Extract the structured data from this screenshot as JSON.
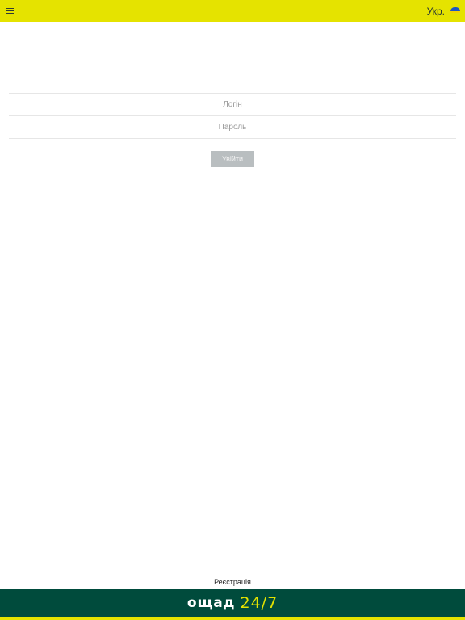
{
  "header": {
    "language_label": "Укр.",
    "menu_icon": "hamburger-menu-icon",
    "flag_icon": "ukraine-flag-icon",
    "accent_color": "#e5e300"
  },
  "login_form": {
    "login_placeholder": "Логін",
    "password_placeholder": "Пароль",
    "login_value": "",
    "password_value": "",
    "submit_label": "Увійти"
  },
  "footer": {
    "register_link": "Реєстрація",
    "logo_word": "ощад",
    "logo_number": "24/7",
    "brand_color": "#004b3c"
  }
}
